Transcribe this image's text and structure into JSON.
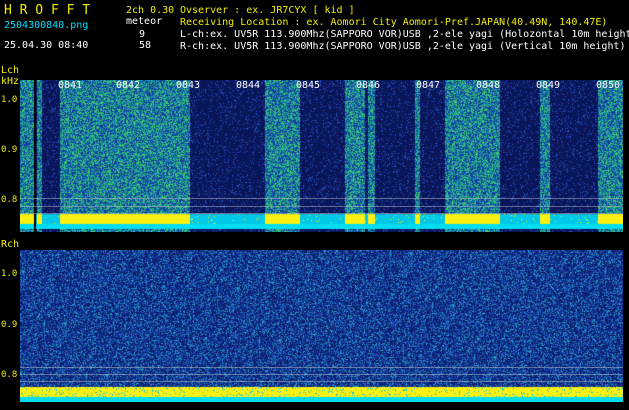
{
  "header": {
    "brand": "H R O F F T",
    "filename": "2504300840.png",
    "timestamp": "25.04.30 08:40",
    "mode": "2ch 0.30",
    "meteor_label": "meteor",
    "count_l": "9",
    "count_r": "58",
    "observer": "Ovserver                : ex. JR7CYX [ kid ]",
    "location": "Receiving Location : ex. Aomori City Aomori-Pref.JAPAN(40.49N, 140.47E)",
    "lch_info": "L-ch:ex. UV5R 113.900Mhz(SAPPORO VOR)USB ,2-ele yagi (Holozontal 10m height)",
    "rch_info": "R-ch:ex. UV5R 113.900Mhz(SAPPORO VOR)USB ,2-ele yagi (Vertical 10m height)"
  },
  "lch": {
    "label": "Lch",
    "unit": "kHz",
    "ticks": [
      "1.0",
      "0.9",
      "0.8"
    ]
  },
  "rch": {
    "label": "Rch",
    "ticks": [
      "1.0",
      "0.9",
      "0.8"
    ]
  },
  "time_labels": [
    "0841",
    "0842",
    "0843",
    "0844",
    "0845",
    "0846",
    "0847",
    "0848",
    "0849",
    "0850"
  ],
  "colors": {
    "background": "#000000",
    "header_yellow": "#e6e600",
    "header_cyan": "#00e0ff",
    "spectrum_dark": "#0a1a6a",
    "spectrum_green": "#33cc66",
    "carrier_yellow": "#ffff00"
  }
}
